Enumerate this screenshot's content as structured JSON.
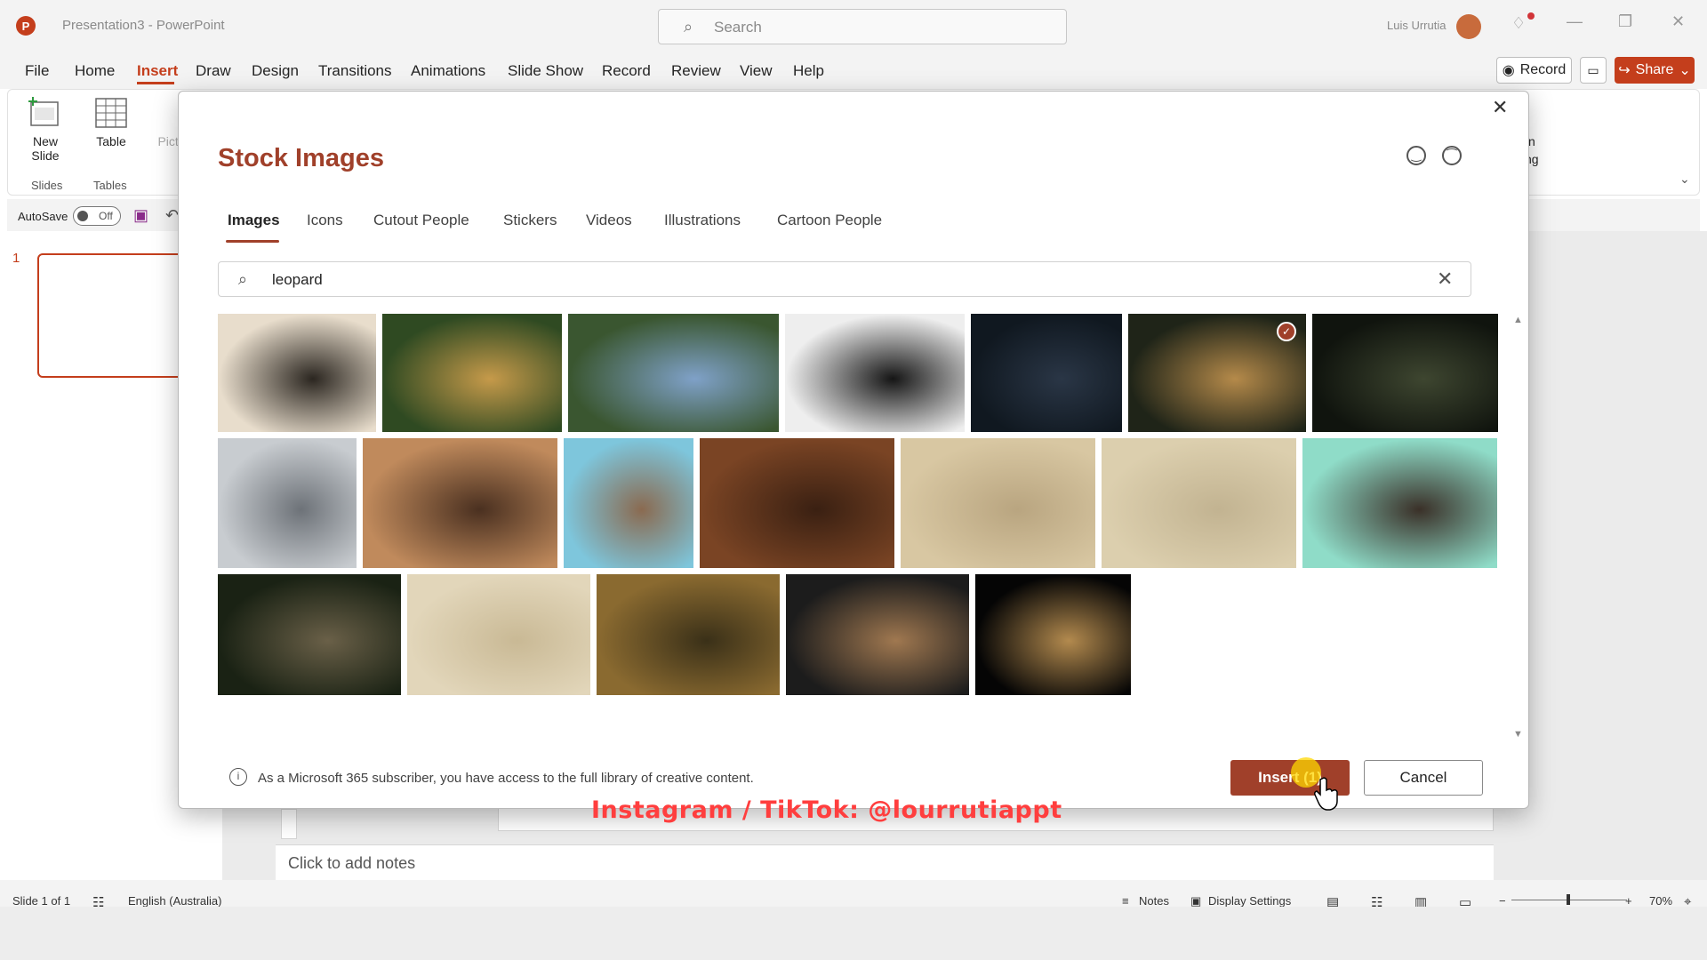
{
  "window": {
    "title": "Presentation3  -  PowerPoint",
    "logo_letter": "P",
    "search_placeholder": "Search",
    "user_name": "Luis Urrutia"
  },
  "menu": {
    "items": [
      "File",
      "Home",
      "Insert",
      "Draw",
      "Design",
      "Transitions",
      "Animations",
      "Slide Show",
      "Record",
      "Review",
      "View",
      "Help"
    ],
    "active": "Insert",
    "record_label": "Record",
    "share_label": "Share"
  },
  "ribbon": {
    "new_slide": "New Slide",
    "table": "Table",
    "pictures": "Pictu",
    "slides_group": "Slides",
    "tables_group": "Tables",
    "partial_right_1": "n",
    "partial_right_2": "ng"
  },
  "qat": {
    "autosave_label": "AutoSave",
    "autosave_state": "Off"
  },
  "slides": {
    "number": "1"
  },
  "notes": {
    "placeholder": "Click to add notes"
  },
  "status": {
    "slide_info": "Slide 1 of 1",
    "language": "English (Australia)",
    "notes": "Notes",
    "display_settings": "Display Settings",
    "zoom": "70%"
  },
  "dialog": {
    "title": "Stock Images",
    "tabs": [
      "Images",
      "Icons",
      "Cutout People",
      "Stickers",
      "Videos",
      "Illustrations",
      "Cartoon People"
    ],
    "active_tab": "Images",
    "search_value": "leopard",
    "info_text": "As a Microsoft 365 subscriber, you have access to the full library of creative content.",
    "insert_label": "Insert (1)",
    "cancel_label": "Cancel",
    "selected_image_index": 5,
    "images": [
      {
        "name": "leopard-fur-pattern",
        "c1": "#e8ddcc",
        "c2": "#2b2620"
      },
      {
        "name": "jaguar-resting-on-log",
        "c1": "#2f4a22",
        "c2": "#c69a4a"
      },
      {
        "name": "leopard-in-tree",
        "c1": "#3a5630",
        "c2": "#7fa1c8"
      },
      {
        "name": "black-panther-profile",
        "c1": "#eeeeee",
        "c2": "#151515"
      },
      {
        "name": "black-panther-dark",
        "c1": "#101820",
        "c2": "#2a3646"
      },
      {
        "name": "leopard-walking",
        "c1": "#1f2418",
        "c2": "#b58a4a"
      },
      {
        "name": "leopard-in-grass-night",
        "c1": "#10140e",
        "c2": "#3e4630"
      },
      {
        "name": "white-tiger",
        "c1": "#c8ccd0",
        "c2": "#6d7278"
      },
      {
        "name": "woman-leopard-print-smiling",
        "c1": "#c08a5c",
        "c2": "#4a3020"
      },
      {
        "name": "leopard-print-shoes",
        "c1": "#7ec6dc",
        "c2": "#8a6a50"
      },
      {
        "name": "leopard-sitting-brown",
        "c1": "#7a4424",
        "c2": "#3a2012"
      },
      {
        "name": "cheetah-in-savanna",
        "c1": "#d8c7a2",
        "c2": "#b9a580"
      },
      {
        "name": "cheetah-cub-in-grass",
        "c1": "#dccfae",
        "c2": "#c2b391"
      },
      {
        "name": "woman-crouching-mint-wall",
        "c1": "#8fdcc8",
        "c2": "#3a3028"
      },
      {
        "name": "clouded-leopard",
        "c1": "#1a2214",
        "c2": "#6a6048"
      },
      {
        "name": "cheetah-hiding-in-grass",
        "c1": "#e2d6ba",
        "c2": "#c9b995"
      },
      {
        "name": "leopard-golden-field",
        "c1": "#8a6a30",
        "c2": "#3a3018"
      },
      {
        "name": "woman-leopard-coat-glasses",
        "c1": "#1c1c1c",
        "c2": "#a07850"
      },
      {
        "name": "cheetah-running-black",
        "c1": "#050505",
        "c2": "#b38a4e"
      }
    ]
  },
  "watermark": "Instagram / TikTok: @lourrutiappt"
}
